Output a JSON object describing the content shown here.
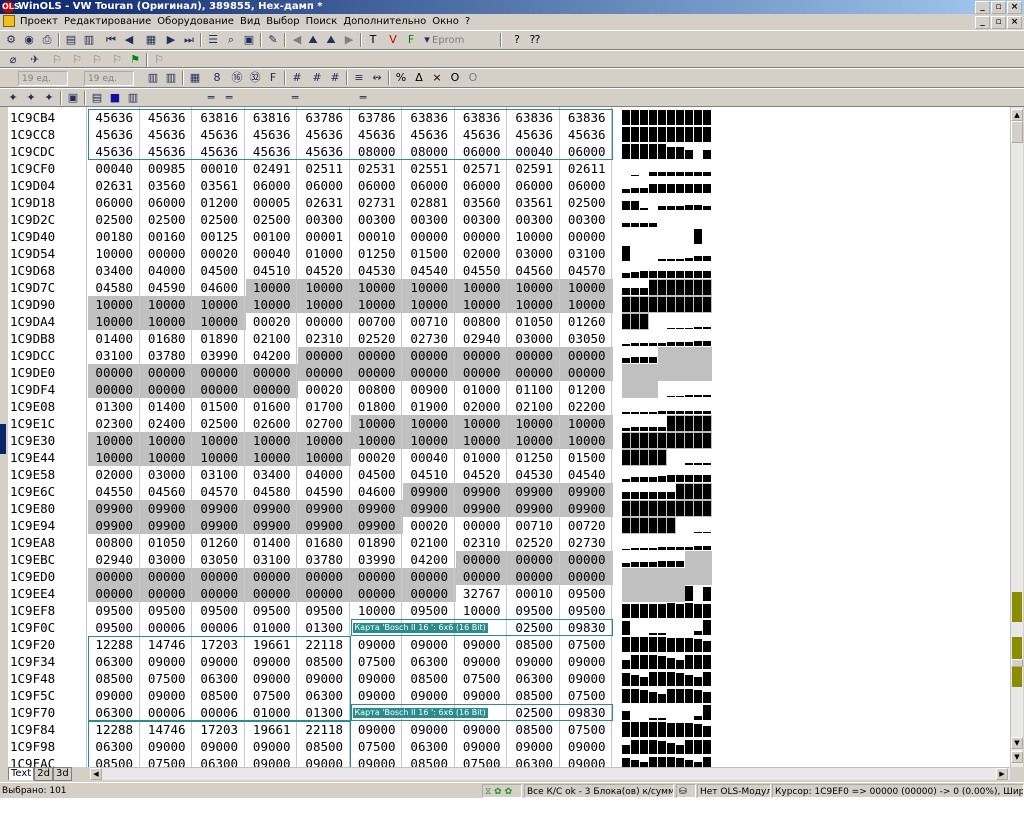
{
  "window": {
    "title": "WinOLS - VW Touran (Оригинал), 389855, Hex-дамп *",
    "app_icon_label": "OLS",
    "btn_min": "_",
    "btn_max": "▫",
    "btn_close": "×"
  },
  "menu": {
    "items": [
      "Проект",
      "Редактирование",
      "Оборудование",
      "Вид",
      "Выбор",
      "Поиск",
      "Дополнительно",
      "Окно",
      "?"
    ]
  },
  "toolbar": {
    "eprom_label": "Eprom",
    "spin1_value": "19 ед.",
    "spin2_value": "19 ед."
  },
  "hex": {
    "addresses": [
      "1C9CB4",
      "1C9CC8",
      "1C9CDC",
      "1C9CF0",
      "1C9D04",
      "1C9D18",
      "1C9D2C",
      "1C9D40",
      "1C9D54",
      "1C9D68",
      "1C9D7C",
      "1C9D90",
      "1C9DA4",
      "1C9DB8",
      "1C9DCC",
      "1C9DE0",
      "1C9DF4",
      "1C9E08",
      "1C9E1C",
      "1C9E30",
      "1C9E44",
      "1C9E58",
      "1C9E6C",
      "1C9E80",
      "1C9E94",
      "1C9EA8",
      "1C9EBC",
      "1C9ED0",
      "1C9EE4",
      "1C9EF8",
      "1C9F0C",
      "1C9F20",
      "1C9F34",
      "1C9F48",
      "1C9F5C",
      "1C9F70",
      "1C9F84",
      "1C9F98",
      "1C9FAC"
    ],
    "rows": [
      [
        "45636",
        "45636",
        "63816",
        "63816",
        "63786",
        "63786",
        "63836",
        "63836",
        "63836",
        "63836"
      ],
      [
        "45636",
        "45636",
        "45636",
        "45636",
        "45636",
        "45636",
        "45636",
        "45636",
        "45636",
        "45636"
      ],
      [
        "45636",
        "45636",
        "45636",
        "45636",
        "45636",
        "08000",
        "08000",
        "06000",
        "00040",
        "06000"
      ],
      [
        "00040",
        "00985",
        "00010",
        "02491",
        "02511",
        "02531",
        "02551",
        "02571",
        "02591",
        "02611"
      ],
      [
        "02631",
        "03560",
        "03561",
        "06000",
        "06000",
        "06000",
        "06000",
        "06000",
        "06000",
        "06000"
      ],
      [
        "06000",
        "06000",
        "01200",
        "00005",
        "02631",
        "02731",
        "02881",
        "03560",
        "03561",
        "02500"
      ],
      [
        "02500",
        "02500",
        "02500",
        "02500",
        "00300",
        "00300",
        "00300",
        "00300",
        "00300",
        "00300"
      ],
      [
        "00180",
        "00160",
        "00125",
        "00100",
        "00001",
        "00010",
        "00000",
        "00000",
        "10000",
        "00000"
      ],
      [
        "10000",
        "00000",
        "00020",
        "00040",
        "01000",
        "01250",
        "01500",
        "02000",
        "03000",
        "03100"
      ],
      [
        "03400",
        "04000",
        "04500",
        "04510",
        "04520",
        "04530",
        "04540",
        "04550",
        "04560",
        "04570"
      ],
      [
        "04580",
        "04590",
        "04600",
        "10000",
        "10000",
        "10000",
        "10000",
        "10000",
        "10000",
        "10000"
      ],
      [
        "10000",
        "10000",
        "10000",
        "10000",
        "10000",
        "10000",
        "10000",
        "10000",
        "10000",
        "10000"
      ],
      [
        "10000",
        "10000",
        "10000",
        "00020",
        "00000",
        "00700",
        "00710",
        "00800",
        "01050",
        "01260"
      ],
      [
        "01400",
        "01680",
        "01890",
        "02100",
        "02310",
        "02520",
        "02730",
        "02940",
        "03000",
        "03050"
      ],
      [
        "03100",
        "03780",
        "03990",
        "04200",
        "00000",
        "00000",
        "00000",
        "00000",
        "00000",
        "00000"
      ],
      [
        "00000",
        "00000",
        "00000",
        "00000",
        "00000",
        "00000",
        "00000",
        "00000",
        "00000",
        "00000"
      ],
      [
        "00000",
        "00000",
        "00000",
        "00000",
        "00020",
        "00800",
        "00900",
        "01000",
        "01100",
        "01200"
      ],
      [
        "01300",
        "01400",
        "01500",
        "01600",
        "01700",
        "01800",
        "01900",
        "02000",
        "02100",
        "02200"
      ],
      [
        "02300",
        "02400",
        "02500",
        "02600",
        "02700",
        "10000",
        "10000",
        "10000",
        "10000",
        "10000"
      ],
      [
        "10000",
        "10000",
        "10000",
        "10000",
        "10000",
        "10000",
        "10000",
        "10000",
        "10000",
        "10000"
      ],
      [
        "10000",
        "10000",
        "10000",
        "10000",
        "10000",
        "00020",
        "00040",
        "01000",
        "01250",
        "01500"
      ],
      [
        "02000",
        "03000",
        "03100",
        "03400",
        "04000",
        "04500",
        "04510",
        "04520",
        "04530",
        "04540"
      ],
      [
        "04550",
        "04560",
        "04570",
        "04580",
        "04590",
        "04600",
        "09900",
        "09900",
        "09900",
        "09900"
      ],
      [
        "09900",
        "09900",
        "09900",
        "09900",
        "09900",
        "09900",
        "09900",
        "09900",
        "09900",
        "09900"
      ],
      [
        "09900",
        "09900",
        "09900",
        "09900",
        "09900",
        "09900",
        "00020",
        "00000",
        "00710",
        "00720"
      ],
      [
        "00800",
        "01050",
        "01260",
        "01400",
        "01680",
        "01890",
        "02100",
        "02310",
        "02520",
        "02730"
      ],
      [
        "02940",
        "03000",
        "03050",
        "03100",
        "03780",
        "03990",
        "04200",
        "00000",
        "00000",
        "00000"
      ],
      [
        "00000",
        "00000",
        "00000",
        "00000",
        "00000",
        "00000",
        "00000",
        "00000",
        "00000",
        "00000"
      ],
      [
        "00000",
        "00000",
        "00000",
        "00000",
        "00000",
        "00000",
        "00000",
        "32767",
        "00010",
        "09500"
      ],
      [
        "09500",
        "09500",
        "09500",
        "09500",
        "09500",
        "10000",
        "09500",
        "10000",
        "09500",
        "09500"
      ],
      [
        "09500",
        "00006",
        "00006",
        "01000",
        "01300",
        "",
        "",
        "",
        "02500",
        "09830"
      ],
      [
        "12288",
        "14746",
        "17203",
        "19661",
        "22118",
        "09000",
        "09000",
        "09000",
        "08500",
        "07500"
      ],
      [
        "06300",
        "09000",
        "09000",
        "09000",
        "08500",
        "07500",
        "06300",
        "09000",
        "09000",
        "09000"
      ],
      [
        "08500",
        "07500",
        "06300",
        "09000",
        "09000",
        "09000",
        "08500",
        "07500",
        "06300",
        "09000"
      ],
      [
        "09000",
        "09000",
        "08500",
        "07500",
        "06300",
        "09000",
        "09000",
        "09000",
        "08500",
        "07500"
      ],
      [
        "06300",
        "00006",
        "00006",
        "01000",
        "01300",
        "",
        "",
        "",
        "02500",
        "09830"
      ],
      [
        "12288",
        "14746",
        "17203",
        "19661",
        "22118",
        "09000",
        "09000",
        "09000",
        "08500",
        "07500"
      ],
      [
        "06300",
        "09000",
        "09000",
        "09000",
        "08500",
        "07500",
        "06300",
        "09000",
        "09000",
        "09000"
      ],
      [
        "08500",
        "07500",
        "06300",
        "09000",
        "09000",
        "09000",
        "08500",
        "07500",
        "06300",
        "09000"
      ]
    ],
    "gray_ranges": [
      [
        10,
        3,
        10
      ],
      [
        11,
        0,
        10
      ],
      [
        12,
        0,
        3
      ],
      [
        14,
        4,
        10
      ],
      [
        15,
        0,
        10
      ],
      [
        16,
        0,
        4
      ],
      [
        18,
        5,
        10
      ],
      [
        19,
        0,
        10
      ],
      [
        20,
        0,
        5
      ],
      [
        22,
        6,
        10
      ],
      [
        23,
        0,
        10
      ],
      [
        24,
        0,
        6
      ],
      [
        26,
        7,
        10
      ],
      [
        27,
        0,
        10
      ],
      [
        28,
        0,
        7
      ]
    ],
    "map_labels": [
      "Карта 'Bosch II 16 ': 6x6 (16 Bit)",
      "Карта 'Bosch II 16 ': 6x6 (16 Bit)"
    ]
  },
  "tabs": [
    "Text",
    "2d",
    "3d"
  ],
  "status": {
    "selected": "Выбрано: 101",
    "checksum": "Все К/С ok - 3 Блока(ов) к/сумм: Ok",
    "module": "Нет OLS-Модуля",
    "cursor": "Курсор: 1C9EF0 => 00000 (00000) -> 0 (0.00%), Ширина: 10"
  }
}
